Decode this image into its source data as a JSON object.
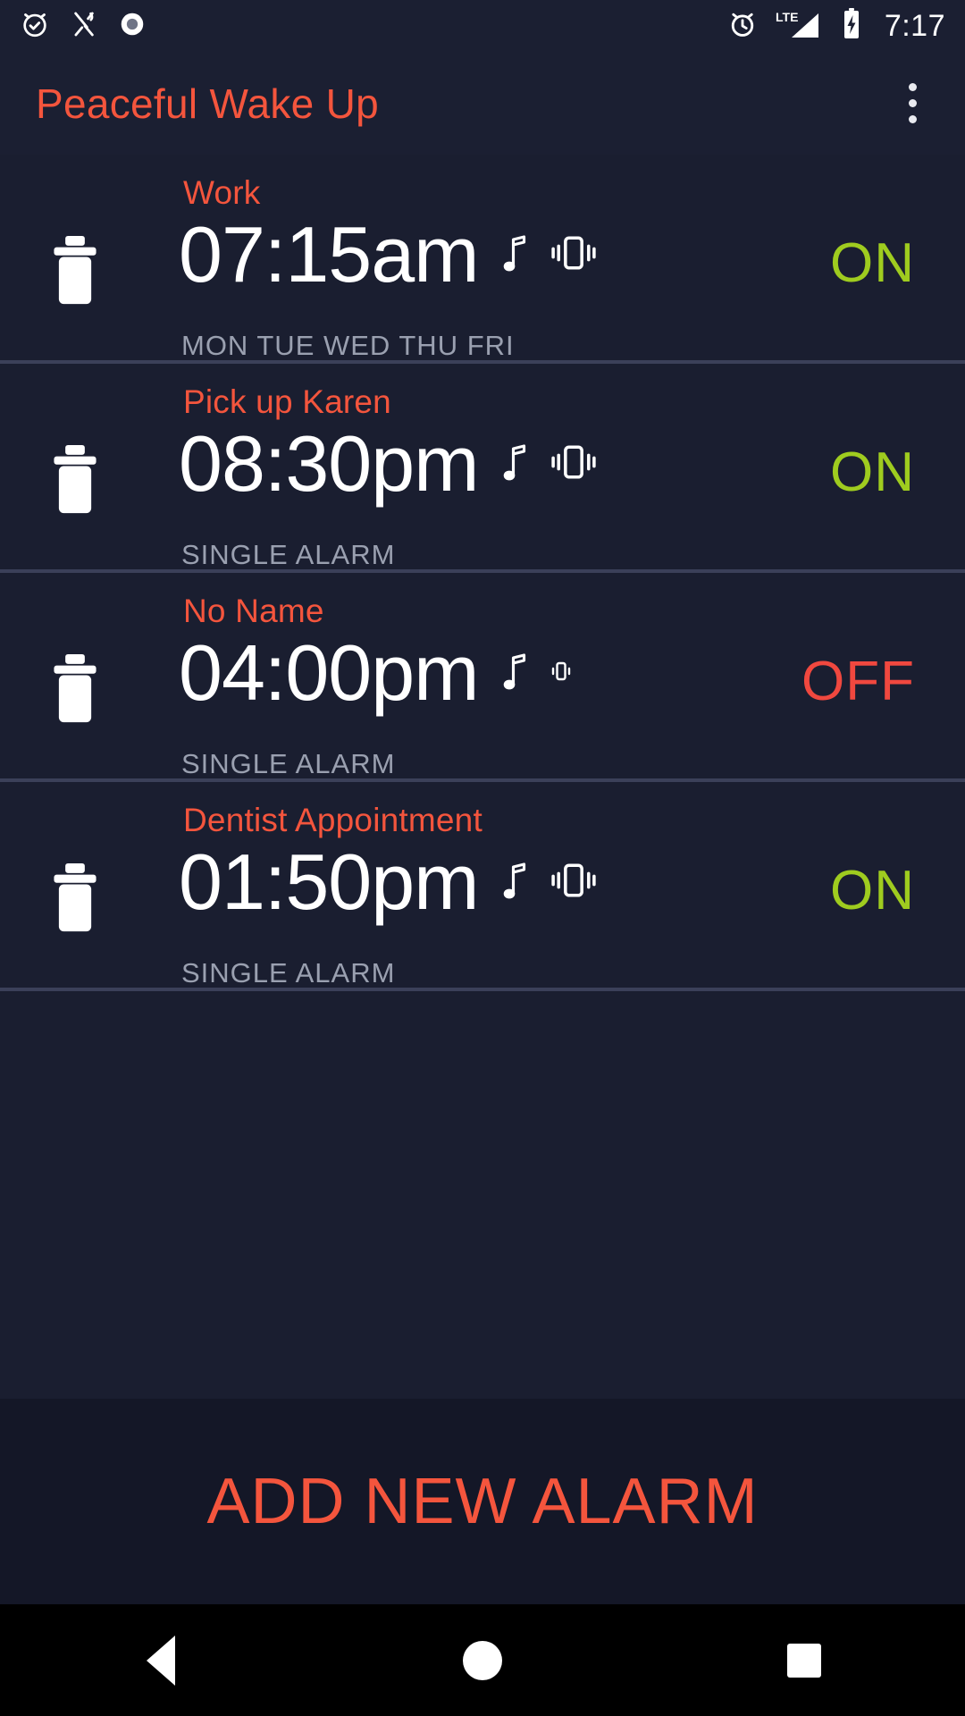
{
  "status_bar": {
    "time": "7:17",
    "network": "LTE",
    "left_icons": [
      "alarm-check-icon",
      "restaurant-icon",
      "record-circle-icon"
    ],
    "right_icons": [
      "alarm-clock-icon",
      "lte-signal-icon",
      "battery-charging-icon"
    ]
  },
  "app_bar": {
    "title": "Peaceful Wake Up",
    "overflow_menu": "more-options"
  },
  "colors": {
    "accent_red": "#f4553d",
    "state_on_green": "#9fcc1f",
    "state_off_red": "#f0483f",
    "row_background": "#1a1e30",
    "bar_background": "#1b1f32",
    "divider": "#3b4059",
    "subtitle_grey": "#9aa0b0"
  },
  "alarms": [
    {
      "label": "Work",
      "time": "07:15am",
      "schedule": "MON TUE WED THU FRI",
      "state": "ON",
      "enabled": true,
      "sound_icon": "music-note-icon",
      "vibrate_icon": "vibration-icon"
    },
    {
      "label": "Pick up Karen",
      "time": "08:30pm",
      "schedule": "SINGLE ALARM",
      "state": "ON",
      "enabled": true,
      "sound_icon": "music-note-icon",
      "vibrate_icon": "vibration-icon"
    },
    {
      "label": "No Name",
      "time": "04:00pm",
      "schedule": "SINGLE ALARM",
      "state": "OFF",
      "enabled": false,
      "sound_icon": "music-note-icon",
      "vibrate_icon": "vibration-icon"
    },
    {
      "label": "Dentist Appointment",
      "time": "01:50pm",
      "schedule": "SINGLE ALARM",
      "state": "ON",
      "enabled": true,
      "sound_icon": "music-note-icon",
      "vibrate_icon": "vibration-icon"
    }
  ],
  "footer": {
    "add_alarm_label": "ADD NEW ALARM"
  },
  "nav_bar": {
    "back": "back-button",
    "home": "home-button",
    "recents": "recents-button"
  }
}
